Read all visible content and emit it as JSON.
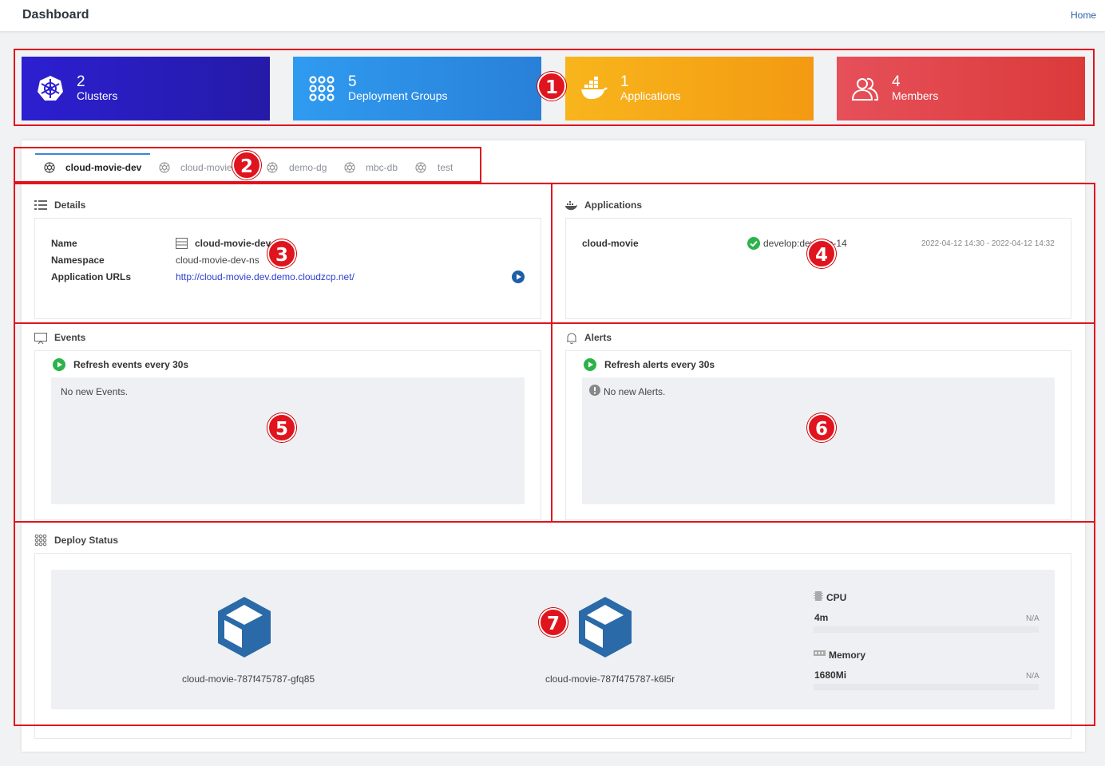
{
  "header": {
    "title": "Dashboard",
    "home_link": "Home"
  },
  "stats": [
    {
      "count": "2",
      "label": "Clusters",
      "icon": "kubernetes-icon",
      "color": "#2c1fd0"
    },
    {
      "count": "5",
      "label": "Deployment Groups",
      "icon": "grid-dots-icon",
      "color": "#2f9bf0"
    },
    {
      "count": "1",
      "label": "Applications",
      "icon": "docker-icon",
      "color": "#f8b51c"
    },
    {
      "count": "4",
      "label": "Members",
      "icon": "users-icon",
      "color": "#e6505a"
    }
  ],
  "tabs": [
    {
      "label": "cloud-movie-dev",
      "active": true
    },
    {
      "label": "cloud-movie",
      "active": false
    },
    {
      "label": "demo-dg",
      "active": false
    },
    {
      "label": "mbc-db",
      "active": false
    },
    {
      "label": "test",
      "active": false
    }
  ],
  "details": {
    "title": "Details",
    "name_label": "Name",
    "name_value": "cloud-movie-dev",
    "namespace_label": "Namespace",
    "namespace_value": "cloud-movie-dev-ns",
    "urls_label": "Application URLs",
    "url_value": "http://cloud-movie.dev.demo.cloudzcp.net/"
  },
  "applications": {
    "title": "Applications",
    "app_name": "cloud-movie",
    "version": "develop:develop-14",
    "time_range": "2022-04-12 14:30 - 2022-04-12 14:32"
  },
  "events": {
    "title": "Events",
    "refresh": "Refresh events every 30s",
    "empty": "No new Events."
  },
  "alerts": {
    "title": "Alerts",
    "refresh": "Refresh alerts every 30s",
    "empty": "No new Alerts."
  },
  "deploy": {
    "title": "Deploy Status",
    "pods": [
      {
        "name": "cloud-movie-787f475787-gfq85"
      },
      {
        "name": "cloud-movie-787f475787-k6l5r"
      }
    ],
    "cpu_label": "CPU",
    "cpu_value": "4m",
    "cpu_limit": "N/A",
    "memory_label": "Memory",
    "memory_value": "1680Mi",
    "memory_limit": "N/A"
  },
  "annotations": [
    "1",
    "2",
    "3",
    "4",
    "5",
    "6",
    "7"
  ],
  "colors": {
    "annotation": "#e0141e",
    "accent_link": "#2a3fd0",
    "ok_green": "#2cb34a",
    "cube_blue": "#2a6aa8"
  }
}
